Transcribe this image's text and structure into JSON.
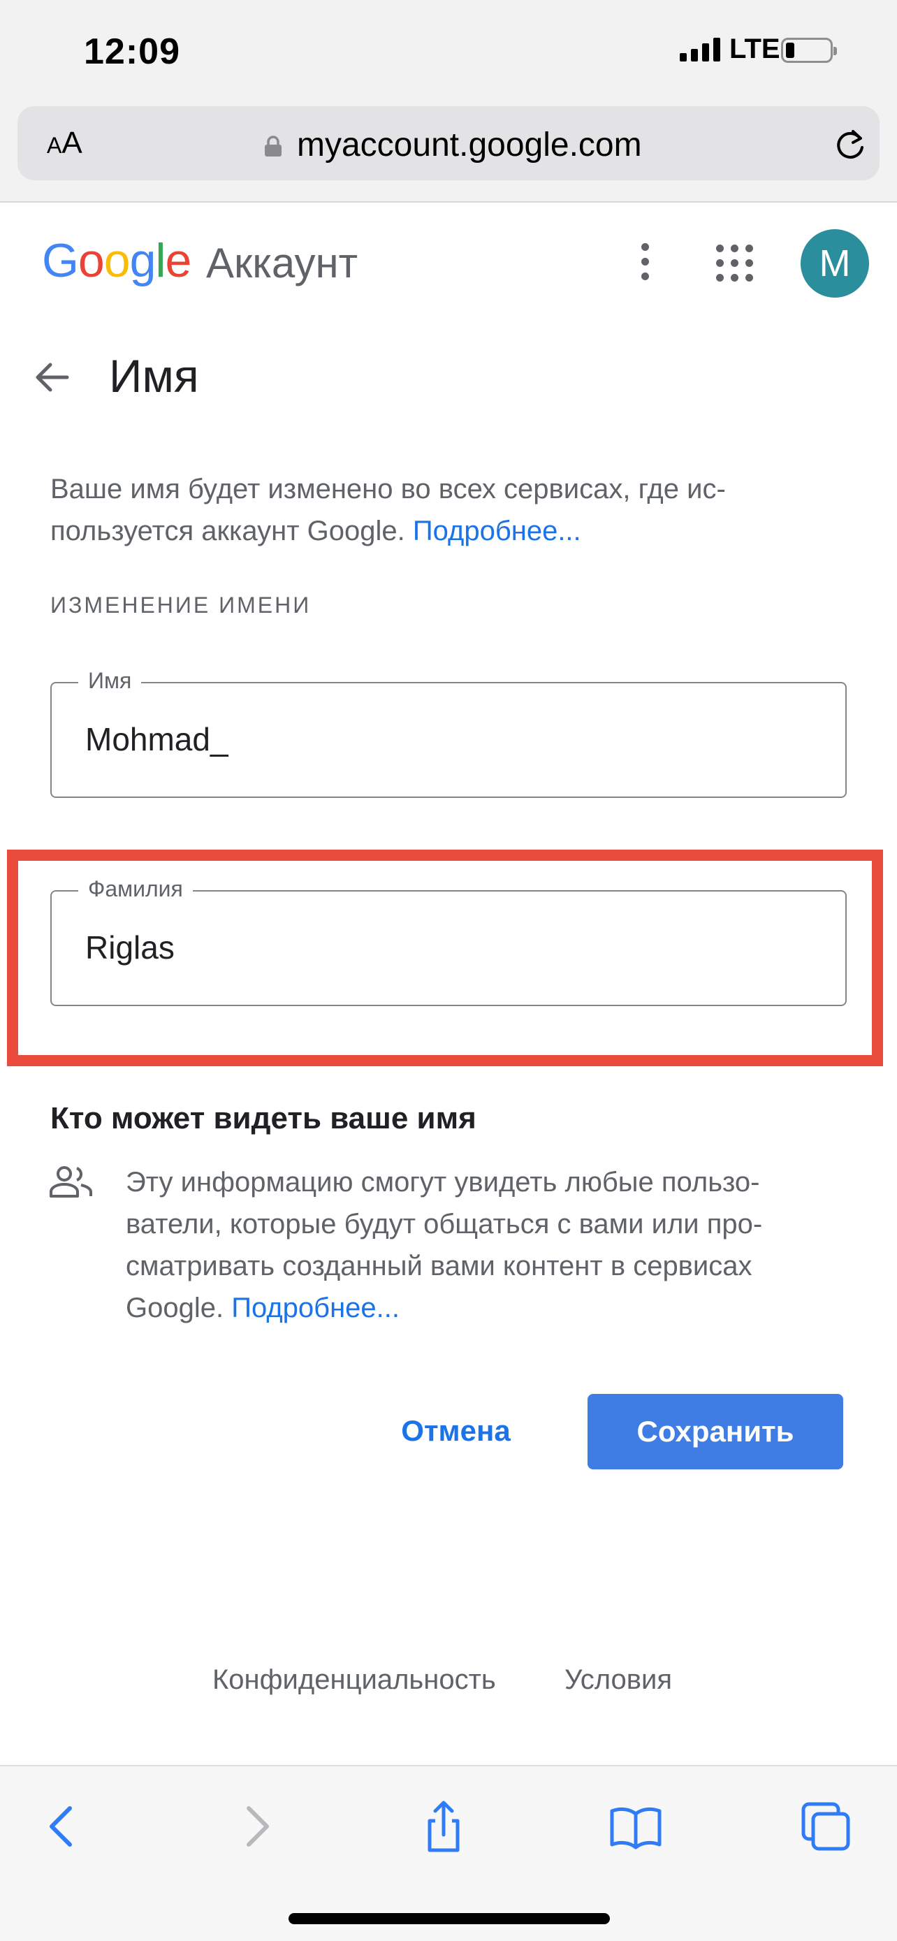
{
  "status_bar": {
    "time": "12:09",
    "network": "LTE"
  },
  "browser": {
    "text_size_label_small": "A",
    "text_size_label_large": "A",
    "url": "myaccount.google.com"
  },
  "header": {
    "logo_letters": [
      "G",
      "o",
      "o",
      "g",
      "l",
      "e"
    ],
    "product": "Аккаунт",
    "avatar_initial": "M"
  },
  "page": {
    "title": "Имя",
    "intro_text": "Ваше имя будет изменено во всех сервисах, где ис-пользуется аккаунт Google. ",
    "intro_link": "Подробнее...",
    "section_label": "ИЗМЕНЕНИЕ ИМЕНИ"
  },
  "form": {
    "first_name": {
      "label": "Имя",
      "value": "Mohmad_"
    },
    "last_name": {
      "label": "Фамилия",
      "value": "Riglas"
    }
  },
  "visibility": {
    "title": "Кто может видеть ваше имя",
    "text": "Эту информацию смогут увидеть любые пользо-ватели, которые будут общаться с вами или про-сматривать созданный вами контент в сервисах Google. ",
    "link": "Подробнее..."
  },
  "actions": {
    "cancel": "Отмена",
    "save": "Сохранить"
  },
  "footer": {
    "privacy": "Конфиденциальность",
    "terms": "Условия"
  },
  "colors": {
    "google_blue": "#4285F4",
    "google_red": "#EA4335",
    "google_yellow": "#FBBC05",
    "google_green": "#34A853",
    "accent_link": "#1a73e8",
    "save_button": "#3f7de4",
    "highlight_frame": "#e94b3c",
    "avatar_bg": "#2a8e9c"
  },
  "icons": {
    "back": "arrow-left-icon",
    "more": "kebab-icon",
    "apps": "apps-grid-icon",
    "lock": "lock-icon",
    "reload": "reload-icon",
    "people": "people-icon",
    "toolbar": [
      "back-icon",
      "forward-icon",
      "share-icon",
      "bookmarks-icon",
      "tabs-icon"
    ]
  }
}
